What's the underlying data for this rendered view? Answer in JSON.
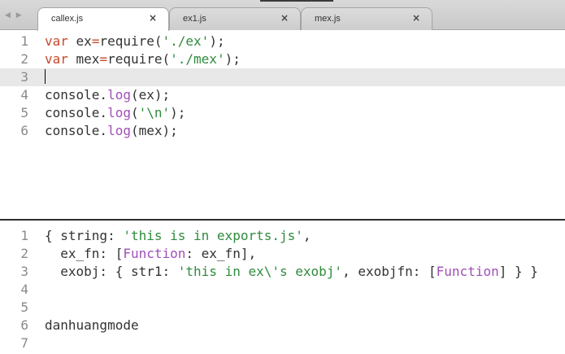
{
  "colors": {
    "keyword": "#c54a2c",
    "string": "#2e8b3c",
    "function": "#a04fb8",
    "text": "#333333",
    "line_number": "#8a8a8a",
    "current_line": "#e8e8e8"
  },
  "nav": {
    "arrows": "◀ ▶"
  },
  "tabs": [
    {
      "label": "callex.js",
      "close": "×",
      "active": true
    },
    {
      "label": "ex1.js",
      "close": "×",
      "active": false
    },
    {
      "label": "mex.js",
      "close": "×",
      "active": false
    }
  ],
  "editor": {
    "lines": [
      {
        "num": "1",
        "tokens": [
          {
            "t": "var",
            "c": "kw"
          },
          {
            "t": " ex",
            "c": "plain"
          },
          {
            "t": "=",
            "c": "op"
          },
          {
            "t": "require(",
            "c": "plain"
          },
          {
            "t": "'./ex'",
            "c": "str"
          },
          {
            "t": ");",
            "c": "plain"
          }
        ]
      },
      {
        "num": "2",
        "tokens": [
          {
            "t": "var",
            "c": "kw"
          },
          {
            "t": " mex",
            "c": "plain"
          },
          {
            "t": "=",
            "c": "op"
          },
          {
            "t": "require(",
            "c": "plain"
          },
          {
            "t": "'./mex'",
            "c": "str"
          },
          {
            "t": ");",
            "c": "plain"
          }
        ]
      },
      {
        "num": "3",
        "tokens": []
      },
      {
        "num": "4",
        "tokens": [
          {
            "t": "console.",
            "c": "plain"
          },
          {
            "t": "log",
            "c": "fn"
          },
          {
            "t": "(ex);",
            "c": "plain"
          }
        ]
      },
      {
        "num": "5",
        "tokens": [
          {
            "t": "console.",
            "c": "plain"
          },
          {
            "t": "log",
            "c": "fn"
          },
          {
            "t": "(",
            "c": "plain"
          },
          {
            "t": "'\\n'",
            "c": "str"
          },
          {
            "t": ");",
            "c": "plain"
          }
        ]
      },
      {
        "num": "6",
        "tokens": [
          {
            "t": "console.",
            "c": "plain"
          },
          {
            "t": "log",
            "c": "fn"
          },
          {
            "t": "(mex);",
            "c": "plain"
          }
        ]
      }
    ]
  },
  "output": {
    "lines": [
      {
        "num": "1",
        "tokens": [
          {
            "t": "{ string: ",
            "c": "plain"
          },
          {
            "t": "'this is in exports.js'",
            "c": "str"
          },
          {
            "t": ",",
            "c": "plain"
          }
        ]
      },
      {
        "num": "2",
        "tokens": [
          {
            "t": "  ex_fn: [",
            "c": "plain"
          },
          {
            "t": "Function",
            "c": "fn"
          },
          {
            "t": ": ex_fn],",
            "c": "plain"
          }
        ]
      },
      {
        "num": "3",
        "tokens": [
          {
            "t": "  exobj: { str1: ",
            "c": "plain"
          },
          {
            "t": "'this in ex\\'s exobj'",
            "c": "str"
          },
          {
            "t": ", exobjfn: [",
            "c": "plain"
          },
          {
            "t": "Function",
            "c": "fn"
          },
          {
            "t": "] } }",
            "c": "plain"
          }
        ]
      },
      {
        "num": "4",
        "tokens": []
      },
      {
        "num": "5",
        "tokens": []
      },
      {
        "num": "6",
        "tokens": [
          {
            "t": "danhuangmode",
            "c": "plain"
          }
        ]
      },
      {
        "num": "7",
        "tokens": []
      }
    ]
  }
}
